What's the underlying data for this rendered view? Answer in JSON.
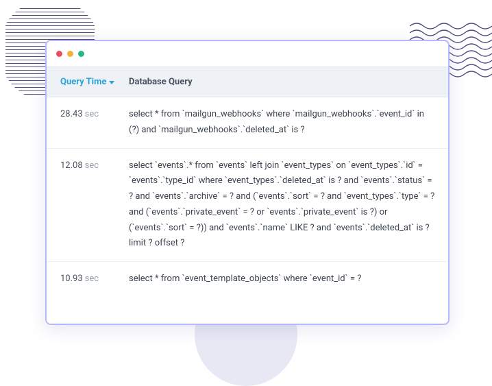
{
  "headers": {
    "query_time": "Query Time",
    "database_query": "Database Query"
  },
  "unit_label": "sec",
  "rows": [
    {
      "time": "28.43",
      "query": "select * from `mailgun_webhooks` where `mailgun_webhooks`.`event_id` in (?) and `mailgun_webhooks`.`deleted_at` is ?"
    },
    {
      "time": "12.08",
      "query": "select `events`.* from `events` left join `event_types` on `event_types`.`id` = `events`.`type_id` where `event_types`.`deleted_at` is ? and `events`.`status` = ? and `events`.`archive` = ? and (`events`.`sort` = ? and `event_types`.`type` = ? and (`events`.`private_event` = ? or `events`.`private_event` is ?) or (`events`.`sort` = ?)) and `events`.`name` LIKE ? and `events`.`deleted_at` is ? limit ? offset ?"
    },
    {
      "time": "10.93",
      "query": "select * from `event_template_objects` where `event_id` = ?"
    }
  ]
}
